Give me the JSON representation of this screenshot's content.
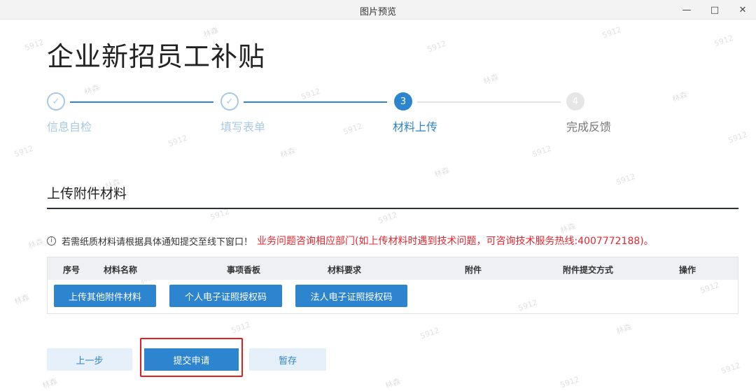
{
  "window": {
    "title": "图片预览",
    "minimize": "—",
    "maximize": "□",
    "close": "✕"
  },
  "page": {
    "title": "企业新招员工补贴"
  },
  "steps": [
    {
      "num": "✓",
      "label": "信息自检",
      "state": "done"
    },
    {
      "num": "✓",
      "label": "填写表单",
      "state": "done"
    },
    {
      "num": "3",
      "label": "材料上传",
      "state": "active"
    },
    {
      "num": "4",
      "label": "完成反馈",
      "state": "todo"
    }
  ],
  "section": {
    "title": "上传附件材料"
  },
  "notice": {
    "icon": "i",
    "text": "若需纸质材料请根据具体通知提交至线下窗口！",
    "highlight": "业务问题咨询相应部门(如上传材料时遇到技术问题，可咨询技术服务热线:4007772188)。"
  },
  "table": {
    "headers": [
      "序号",
      "材料名称",
      "事项香板",
      "材料要求",
      "附件",
      "附件提交方式",
      "操作"
    ]
  },
  "upload_buttons": [
    "上传其他附件材料",
    "个人电子证照授权码",
    "法人电子证照授权码"
  ],
  "footer": {
    "prev": "上一步",
    "submit": "提交申请",
    "save": "暂存"
  },
  "colors": {
    "primary": "#2d84cf",
    "highlight": "#e02020",
    "notice_red": "#e8262e"
  }
}
